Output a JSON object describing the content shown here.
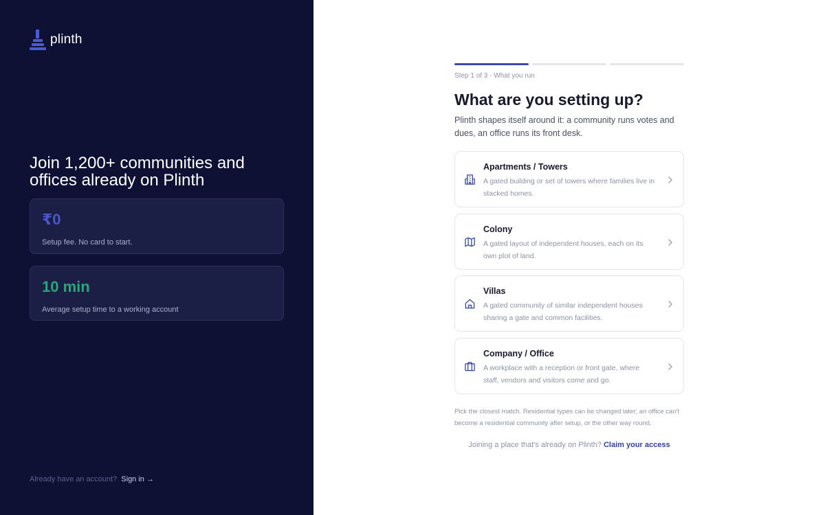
{
  "brand": {
    "name": "plinth",
    "icon": "plinth-logo-icon",
    "accent": "#4a5bd4"
  },
  "left_panel": {
    "headline": "Join 1,200+ communities and offices already on Plinth",
    "stats": [
      {
        "value": "₹0",
        "label": "Setup fee. No card to start.",
        "color": "#4858c6"
      },
      {
        "value": "10 min",
        "label": "Average setup time to a working account",
        "color": "#28a878"
      }
    ],
    "signin_prompt": "Already have an account?",
    "signin_link": "Sign in →"
  },
  "onboarding": {
    "progress": {
      "current_step": 1,
      "total_steps": 3
    },
    "step_label": "Step 1 of 3 · What you run",
    "title": "What are you setting up?",
    "subtitle": "Plinth shapes itself around it: a community runs votes and dues, an office runs its front desk.",
    "options": [
      {
        "title": "Apartments / Towers",
        "description": "A gated building or set of towers where families live in stacked homes.",
        "icon": "building-icon"
      },
      {
        "title": "Colony",
        "description": "A gated layout of independent houses, each on its own plot of land.",
        "icon": "map-icon"
      },
      {
        "title": "Villas",
        "description": "A gated community of similar independent houses sharing a gate and common facilities.",
        "icon": "house-icon"
      },
      {
        "title": "Company / Office",
        "description": "A workplace with a reception or front gate, where staff, vendors and visitors come and go.",
        "icon": "briefcase-icon"
      }
    ],
    "hint": "Pick the closest match. Residential types can be changed later; an office can't become a residential community after setup, or the other way round.",
    "join_prompt": "Joining a place that's already on Plinth?",
    "claim_link": "Claim your access"
  },
  "colors": {
    "left_bg": "#0f1134",
    "primary": "#3a4aa8",
    "option_icon": "#2e3f9e"
  }
}
